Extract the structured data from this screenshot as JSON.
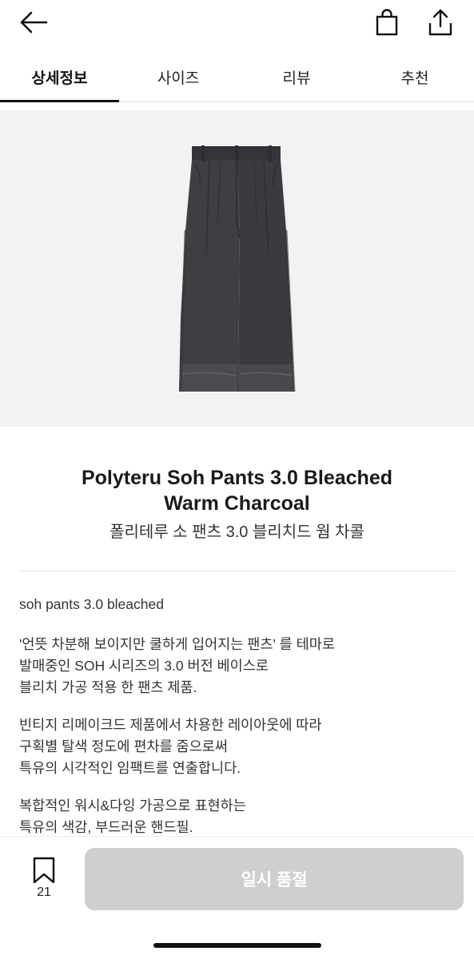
{
  "tabs": [
    {
      "label": "상세정보"
    },
    {
      "label": "사이즈"
    },
    {
      "label": "리뷰"
    },
    {
      "label": "추천"
    }
  ],
  "product": {
    "title_en_line1": "Polyteru Soh Pants 3.0 Bleached",
    "title_en_line2": "Warm Charcoal",
    "title_ko": "폴리테루 소 팬츠 3.0 블리치드 웜 차콜",
    "image_icon": "pants-image"
  },
  "description": {
    "subtitle": "soh pants 3.0 bleached",
    "p1": [
      "'언뜻 차분해 보이지만 쿨하게 입어지는 팬츠' 를 테마로",
      "발매중인 SOH 시리즈의 3.0 버전 베이스로",
      "블리치 가공 적용 한 팬츠 제품."
    ],
    "p2": [
      "빈티지 리메이크드 제품에서 차용한 레이아웃에 따라",
      "구획별 탈색 정도에 편차를 줌으로써",
      "특유의 시각적인 임팩트를 연출합니다."
    ],
    "p3": [
      "복합적인 워시&다잉 가공으로 표현하는",
      "특유의 색감, 부드러운 핸드필."
    ]
  },
  "bottom": {
    "wish_count": "21",
    "soldout_label": "일시 품절"
  },
  "colors": {
    "accent": "#111111",
    "disabled_button": "#cfcfcf",
    "hero_bg": "#f2f2f2",
    "pants": "#3c3d40"
  }
}
